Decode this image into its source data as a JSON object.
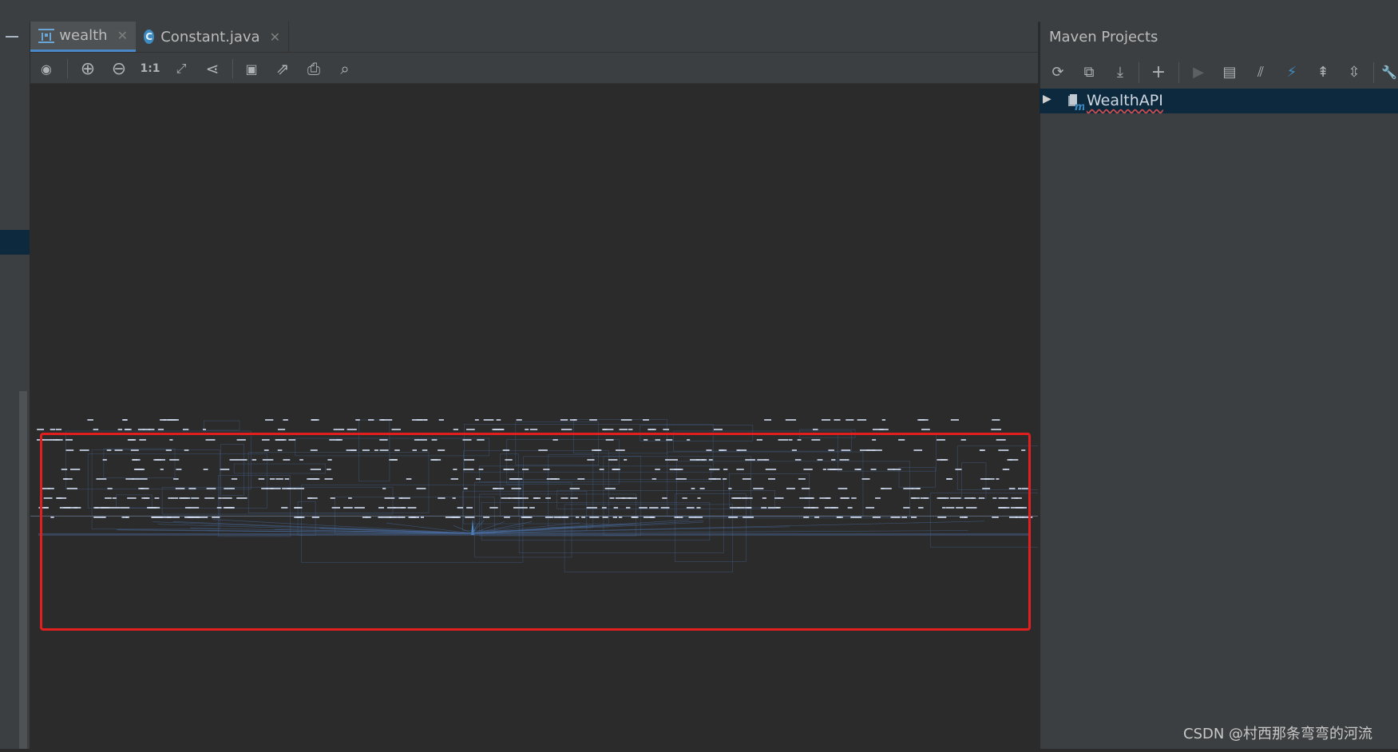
{
  "editor": {
    "tabs": [
      {
        "label": "wealth",
        "icon": "diagram-icon",
        "active": true
      },
      {
        "label": "Constant.java",
        "icon": "java-class-icon",
        "active": false
      }
    ],
    "toolbar": [
      {
        "name": "view-options-icon",
        "glyph": "◉"
      },
      {
        "name": "zoom-in-icon",
        "glyph": "⊕"
      },
      {
        "name": "zoom-out-icon",
        "glyph": "⊖"
      },
      {
        "name": "actual-size-icon",
        "glyph": "1:1"
      },
      {
        "name": "fit-content-icon",
        "glyph": "⤢"
      },
      {
        "name": "layout-icon",
        "glyph": "⋖"
      },
      {
        "name": "save-icon",
        "glyph": "▣"
      },
      {
        "name": "export-icon",
        "glyph": "⇗"
      },
      {
        "name": "print-icon",
        "glyph": "⎙"
      },
      {
        "name": "print-preview-icon",
        "glyph": "⌕"
      }
    ]
  },
  "maven": {
    "title": "Maven Projects",
    "toolbar": [
      {
        "name": "reimport-icon",
        "glyph": "⟳"
      },
      {
        "name": "generate-sources-icon",
        "glyph": "⧉"
      },
      {
        "name": "download-icon",
        "glyph": "⤓"
      },
      {
        "name": "add-project-icon",
        "glyph": "+"
      },
      {
        "name": "run-icon",
        "glyph": "▶"
      },
      {
        "name": "execute-goal-icon",
        "glyph": "▤"
      },
      {
        "name": "toggle-offline-icon",
        "glyph": "⫽"
      },
      {
        "name": "skip-tests-icon",
        "glyph": "⚡"
      },
      {
        "name": "show-dependencies-icon",
        "glyph": "⇞"
      },
      {
        "name": "collapse-all-icon",
        "glyph": "⇳"
      },
      {
        "name": "settings-icon",
        "glyph": "🔧"
      }
    ],
    "project": "WealthAPI"
  },
  "colors": {
    "background": "#2b2b2b",
    "panel": "#3c3f41",
    "selection": "#0d293e",
    "highlight_border": "#e11f1f",
    "diagram_lines": "#4a6fa5"
  },
  "watermark": "CSDN @村西那条弯弯的河流"
}
